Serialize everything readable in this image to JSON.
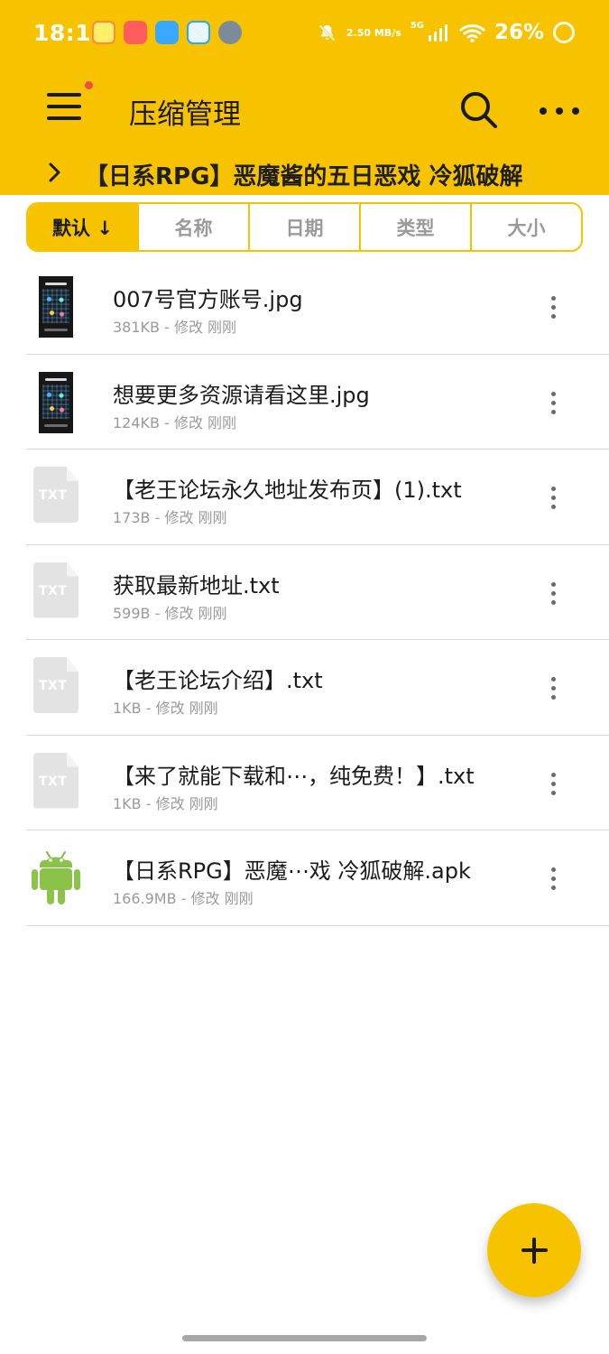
{
  "status_bar": {
    "time": "18:11",
    "network_speed": "2.50 MB/s",
    "network_type": "5G",
    "battery": "26%",
    "icons": [
      "app-icon",
      "app-icon",
      "app-icon",
      "app-icon",
      "app-icon",
      "mute-bell-icon",
      "signal-icon",
      "wifi-icon",
      "battery-icon"
    ]
  },
  "header": {
    "title": "压缩管理",
    "breadcrumb": "【日系RPG】恶魔酱的五日恶戏  冷狐破解",
    "icons": [
      "menu-icon",
      "search-icon",
      "more-icon"
    ],
    "accent_color": "#f7c300"
  },
  "sort_tabs": [
    {
      "label": "默认 ↓",
      "active": true
    },
    {
      "label": "名称",
      "active": false
    },
    {
      "label": "日期",
      "active": false
    },
    {
      "label": "类型",
      "active": false
    },
    {
      "label": "大小",
      "active": false
    }
  ],
  "files": [
    {
      "name": "007号官方账号.jpg",
      "meta": "381KB - 修改 刚刚",
      "icon": "image-thumbnail-icon"
    },
    {
      "name": "想要更多资源请看这里.jpg",
      "meta": "124KB - 修改 刚刚",
      "icon": "image-thumbnail-icon"
    },
    {
      "name": "【老王论坛永久地址发布页】(1).txt",
      "meta": "173B - 修改 刚刚",
      "icon": "txt-file-icon",
      "icon_label": "TXT"
    },
    {
      "name": "获取最新地址.txt",
      "meta": "599B - 修改 刚刚",
      "icon": "txt-file-icon",
      "icon_label": "TXT"
    },
    {
      "name": "【老王论坛介绍】.txt",
      "meta": "1KB - 修改 刚刚",
      "icon": "txt-file-icon",
      "icon_label": "TXT"
    },
    {
      "name": "【来了就能下载和⋯，纯免费！】.txt",
      "meta": "1KB - 修改 刚刚",
      "icon": "txt-file-icon",
      "icon_label": "TXT"
    },
    {
      "name": "【日系RPG】恶魔⋯戏  冷狐破解.apk",
      "meta": "166.9MB - 修改 刚刚",
      "icon": "android-icon"
    }
  ],
  "fab": {
    "icon": "plus-icon"
  }
}
